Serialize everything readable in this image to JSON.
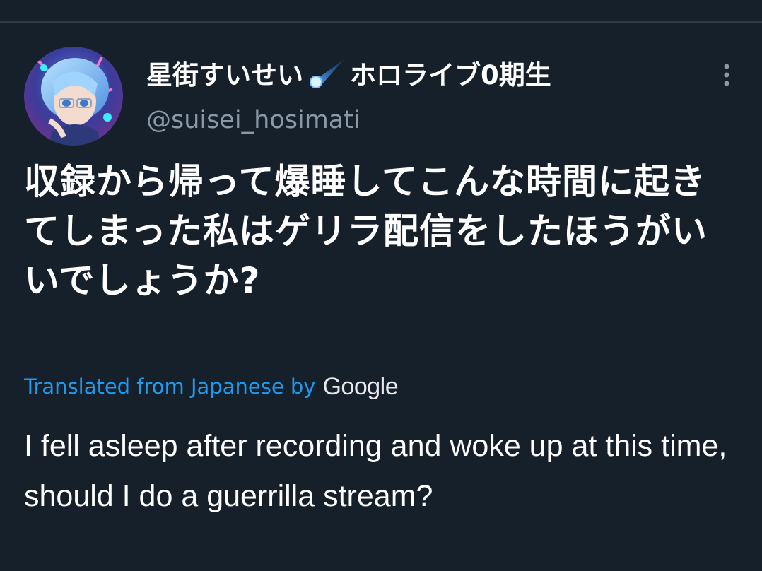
{
  "tweet": {
    "display_name_prefix": "星街すいせい",
    "display_name_suffix": "ホロライブ0期生",
    "handle": "@suisei_hosimati",
    "text": "収録から帰って爆睡してこんな時間に起きてしまった私はゲリラ配信をしたほうがいいでしょうか?",
    "translated_label": "Translated from Japanese by",
    "translator_name": "Google",
    "translation": "I fell asleep after recording and woke up at this time, should I do a guerrilla stream?"
  },
  "icons": {
    "avatar": "avatar-image",
    "name_emoji": "comet-icon",
    "menu": "more-options-icon"
  },
  "colors": {
    "background": "#15202b",
    "text_primary": "#ffffff",
    "text_secondary": "#8b98a5",
    "link": "#1d9bf0"
  }
}
